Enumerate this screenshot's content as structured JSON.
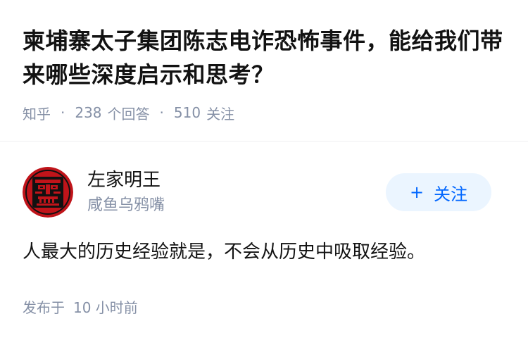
{
  "question": {
    "title": "柬埔寨太子集团陈志电诈恐怖事件，能给我们带来哪些深度启示和思考？",
    "source": "知乎",
    "answer_count": "238",
    "answer_label": "个回答",
    "follower_count": "510",
    "follower_label": "关注",
    "separator": "·"
  },
  "author": {
    "name": "左家明王",
    "bio": "咸鱼乌鸦嘴",
    "avatar_icon": "avatar-mask-icon",
    "avatar_colors": {
      "ring": "#c0141a",
      "mask": "#111111"
    }
  },
  "follow": {
    "plus": "+",
    "label": "关注"
  },
  "answer": {
    "text": "人最大的历史经验就是，不会从历史中吸取经验。"
  },
  "publish": {
    "label": "发布于",
    "time": "10 小时前"
  },
  "colors": {
    "accent": "#0066ff",
    "accent_bg": "#ebf5ff",
    "muted": "#8590a6",
    "text": "#121212"
  }
}
